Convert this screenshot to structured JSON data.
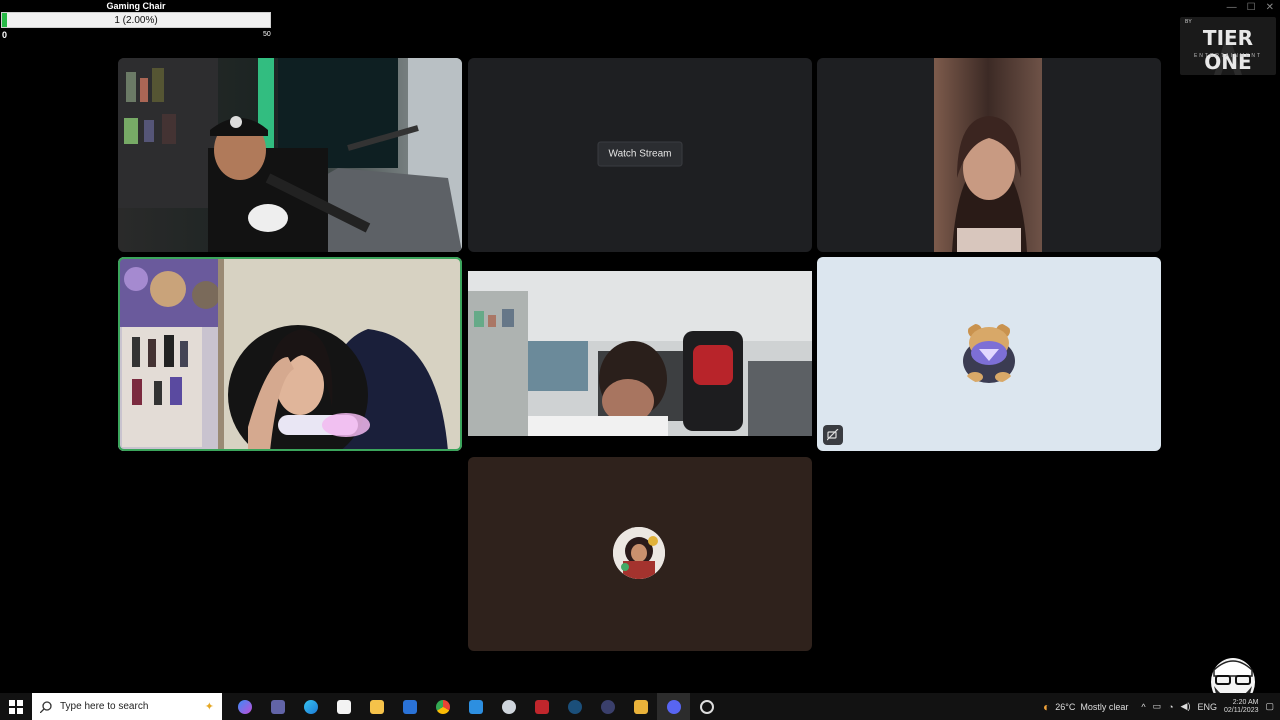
{
  "goal": {
    "title": "Gaming Chair",
    "value_text": "1 (2.00%)",
    "progress_fraction": 0.02,
    "min": "0",
    "max": "50"
  },
  "watermark": {
    "by": "BY",
    "name": "TIER ONE",
    "sub": "ENTERTAINMENT"
  },
  "tiles": {
    "watch_stream_label": "Watch Stream"
  },
  "taskbar": {
    "search_placeholder": "Type here to search",
    "weather_temp": "26°C",
    "weather_desc": "Mostly clear",
    "language": "ENG",
    "time": "2:20 AM",
    "date": "02/11/2023"
  },
  "colors": {
    "speaking_outline": "#3ba55c",
    "tile_bg": "#1e1f22",
    "goal_fill": "#27b946"
  }
}
